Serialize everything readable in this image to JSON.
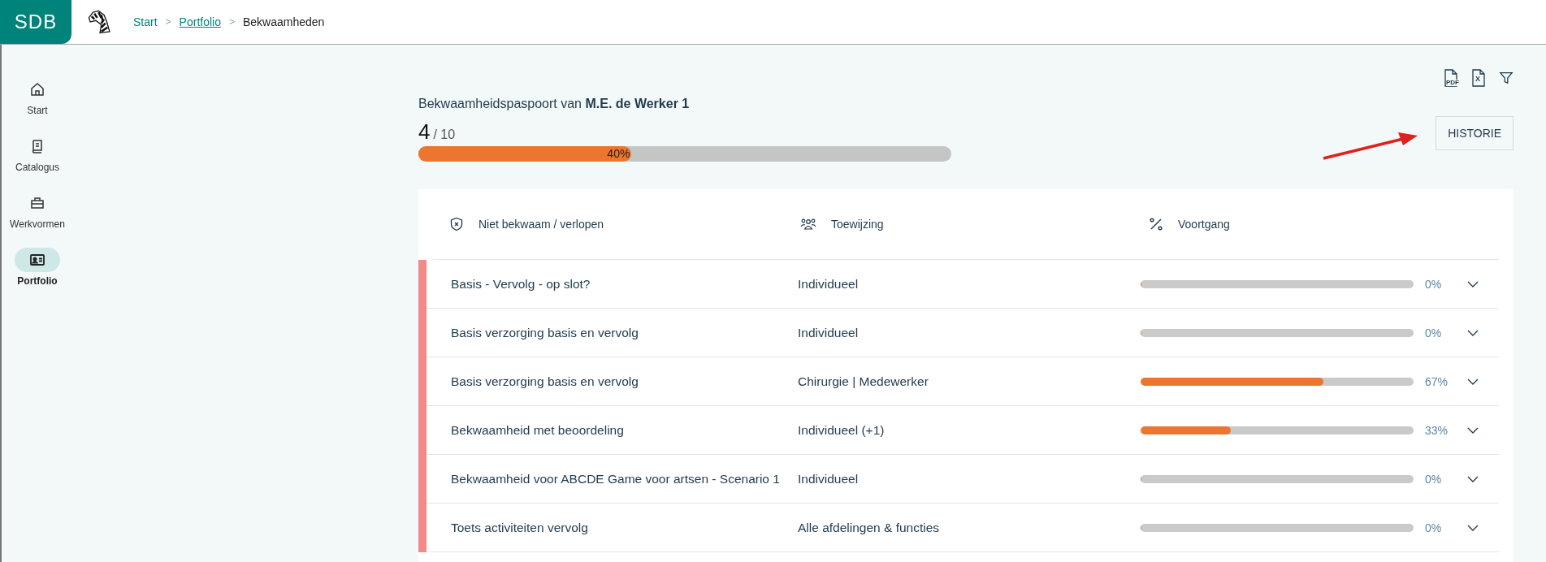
{
  "header": {
    "logo": "SDB",
    "breadcrumbs": [
      {
        "label": "Start",
        "current": false,
        "underlined": false
      },
      {
        "label": "Portfolio",
        "current": false,
        "underlined": true
      },
      {
        "label": "Bekwaamheden",
        "current": true,
        "underlined": false
      }
    ],
    "separator": ">"
  },
  "sidebar": {
    "items": [
      {
        "label": "Start",
        "selected": false
      },
      {
        "label": "Catalogus",
        "selected": false
      },
      {
        "label": "Werkvormen",
        "selected": false
      },
      {
        "label": "Portfolio",
        "selected": true
      }
    ]
  },
  "toolbar": {
    "export_pdf": "PDF",
    "export_excel": "X"
  },
  "passport": {
    "title": "Bekwaamheidspaspoort van **M.E. de Werker 1**",
    "count": "4",
    "total": "/ 10",
    "level": 0.4,
    "reading": "40%"
  },
  "history_button": "HISTORIE",
  "annotation": {
    "arrow": true
  },
  "table": {
    "columns": [
      {
        "label": "Niet bekwaam / verlopen"
      },
      {
        "label": "Toewijzing"
      },
      {
        "label": "Voortgang"
      }
    ],
    "rows": [
      {
        "name": "Basis - Vervolg - op slot?",
        "assignment": "Individueel",
        "level": 0,
        "reading": "0%",
        "expired": true,
        "expanded": false
      },
      {
        "name": "Basis verzorging basis en vervolg",
        "assignment": "Individueel",
        "level": 0,
        "reading": "0%",
        "expired": true,
        "expanded": false
      },
      {
        "name": "Basis verzorging basis en vervolg",
        "assignment": "Chirurgie | Medewerker",
        "level": 0.67,
        "reading": "67%",
        "expired": true,
        "expanded": false
      },
      {
        "name": "Bekwaamheid met beoordeling",
        "assignment": "Individueel (+1)",
        "level": 0.33,
        "reading": "33%",
        "expired": true,
        "expanded": false
      },
      {
        "name": "Bekwaamheid voor ABCDE Game voor artsen - Scenario 1",
        "assignment": "Individueel",
        "level": 0,
        "reading": "0%",
        "expired": true,
        "expanded": false
      },
      {
        "name": "Toets activiteiten vervolg",
        "assignment": "Alle afdelingen & functies",
        "level": 0,
        "reading": "0%",
        "expired": true,
        "expanded": false
      }
    ]
  }
}
